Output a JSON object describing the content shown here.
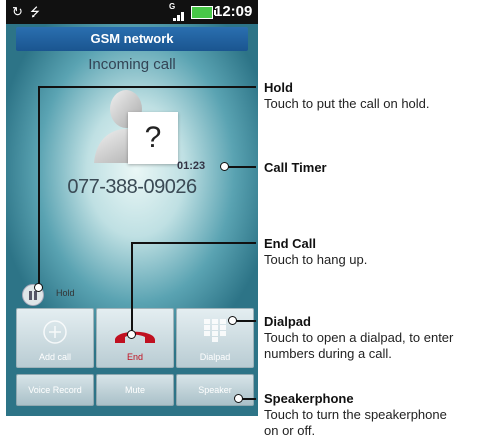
{
  "status_bar": {
    "sync_icon": "sync-icon",
    "usb_icon": "usb-icon",
    "network_type": "G",
    "clock": "12:09"
  },
  "network": "GSM network",
  "call_state": "Incoming call",
  "caller": {
    "avatar": "unknown-contact-icon",
    "avatar_mark": "?",
    "timer": "01:23",
    "number": "077-388-09026"
  },
  "hold": {
    "label": "Hold"
  },
  "buttons": {
    "add_call": "Add call",
    "end": "End",
    "dialpad": "Dialpad",
    "voice_record": "Voice Record",
    "mute": "Mute",
    "speaker": "Speaker"
  },
  "callouts": [
    {
      "title": "Hold",
      "desc": "Touch to put the call on hold."
    },
    {
      "title": "Call Timer",
      "desc": ""
    },
    {
      "title": "End Call",
      "desc": "Touch to hang up."
    },
    {
      "title": "Dialpad",
      "desc": "Touch to open a dialpad, to enter numbers during a call."
    },
    {
      "title": "Speakerphone",
      "desc": "Touch to turn the speakerphone on or off."
    }
  ],
  "colors": {
    "end_red": "#c01020",
    "network_blue": "#1a5590"
  }
}
